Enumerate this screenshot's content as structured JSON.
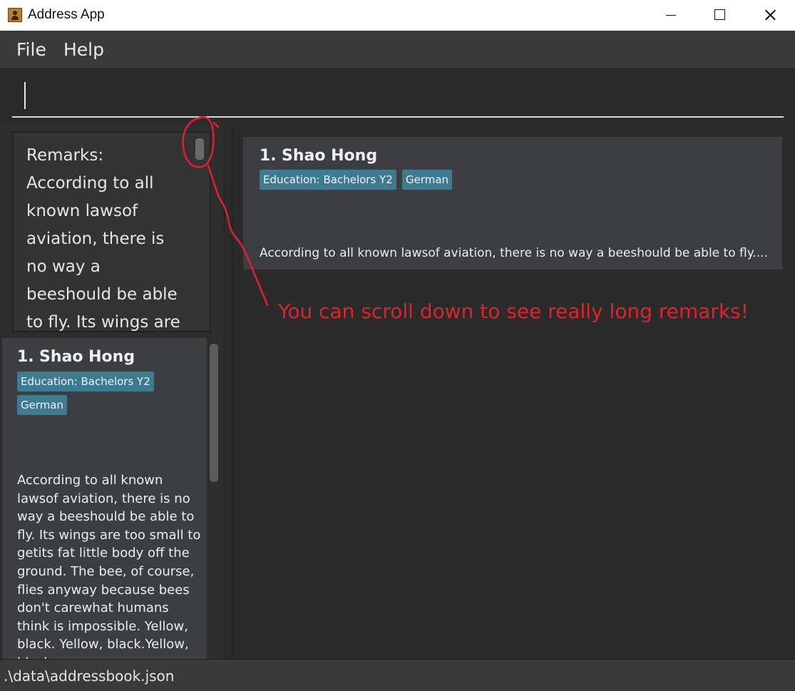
{
  "window": {
    "title": "Address App"
  },
  "menu": {
    "file": "File",
    "help": "Help"
  },
  "command_box": {
    "value": ""
  },
  "remark_panel": {
    "text": "Remarks: According to all known lawsof aviation,  there is no way a beeshould be able to fly.  Its wings are too small to getits"
  },
  "person_list": [
    {
      "index": "1.",
      "name": "Shao Hong",
      "tags": [
        "Education: Bachelors Y2",
        "German"
      ],
      "remark": "According to all known lawsof aviation,  there is no way a beeshould be able to fly.  Its wings are too small to getits fat little body off the ground.  The bee, of course, flies anyway  because bees don't carewhat humans think is impossible.  Yellow, black. Yellow, black.Yellow, black."
    }
  ],
  "detail": {
    "index": "1.",
    "name": "Shao Hong",
    "tags": [
      "Education: Bachelors Y2",
      "German"
    ],
    "remark": "According to all known lawsof aviation,  there is no way a beeshould be able to fly...."
  },
  "annotation": {
    "text": "You can scroll down to see really long remarks!",
    "color": "#e0222c"
  },
  "status": {
    "path": ".\\data\\addressbook.json"
  },
  "colors": {
    "background": "#2b2b2b",
    "card": "#3c3e42",
    "tag": "#3e7b91",
    "menubar": "#3a3a3a"
  }
}
